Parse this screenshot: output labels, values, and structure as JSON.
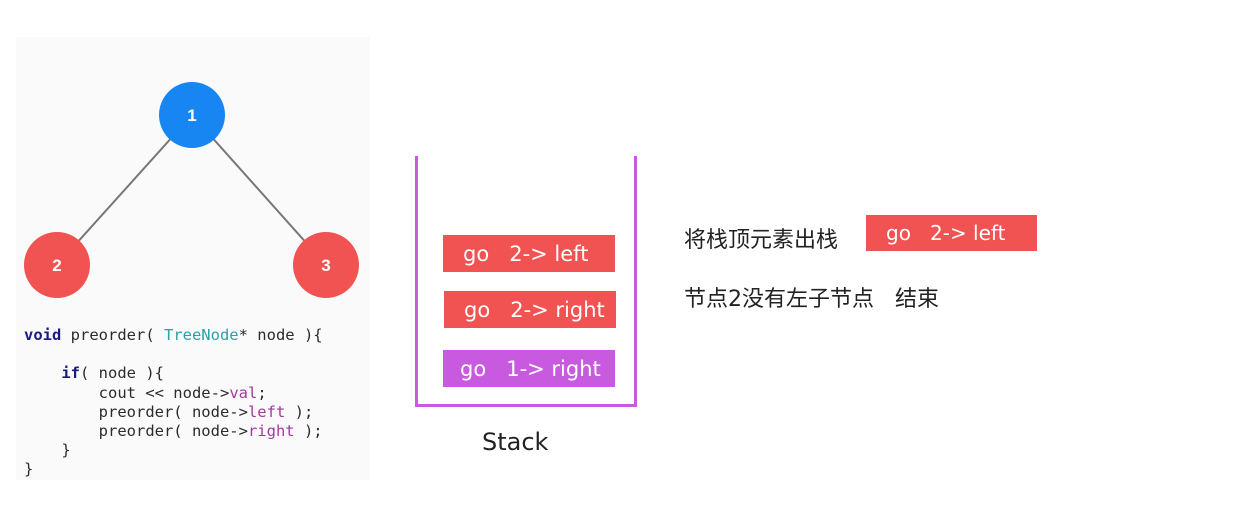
{
  "tree": {
    "nodes": [
      {
        "id": "1",
        "label": "1",
        "color": "#1786f2"
      },
      {
        "id": "2",
        "label": "2",
        "color": "#f15252"
      },
      {
        "id": "3",
        "label": "3",
        "color": "#f15252"
      }
    ],
    "edge_color": "#777777"
  },
  "code": {
    "lines": [
      "void preorder( TreeNode* node ){",
      "",
      "    if( node ){",
      "        cout << node->val;",
      "        preorder( node->left );",
      "        preorder( node->right );",
      "    }",
      "}"
    ]
  },
  "stack": {
    "label": "Stack",
    "border_color": "#c85ae0",
    "frames": [
      {
        "text": "go   2-> left",
        "color": "#f15252"
      },
      {
        "text": "go   2-> right",
        "color": "#f15252"
      },
      {
        "text": "go   1-> right",
        "color": "#c85ae0"
      }
    ]
  },
  "notes": {
    "line1": "将栈顶元素出栈",
    "popped_frame": "go   2-> left",
    "line2": "节点2没有左子节点   结束"
  }
}
